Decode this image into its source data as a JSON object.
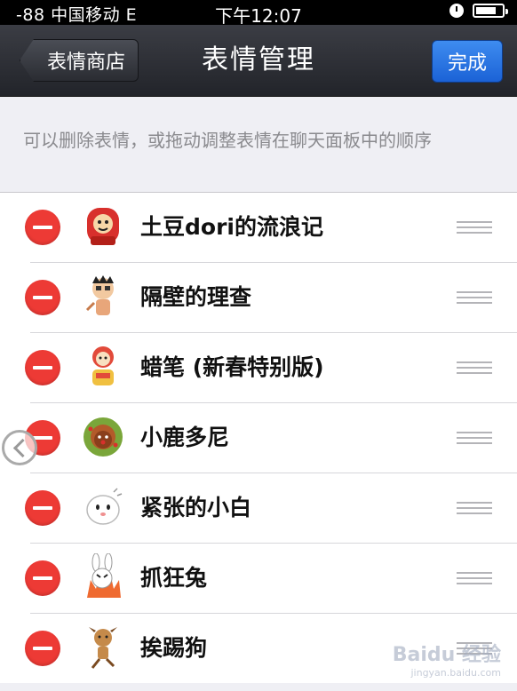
{
  "status_bar": {
    "signal": "-88 中国移动  E",
    "time": "下午12:07"
  },
  "nav": {
    "back_label": "表情商店",
    "title": "表情管理",
    "done_label": "完成"
  },
  "hint": "可以删除表情，或拖动调整表情在聊天面板中的顺序",
  "packs": [
    {
      "name": "土豆dori的流浪记",
      "icon": "potato-girl-icon",
      "color": "#d8302c"
    },
    {
      "name": "隔壁的理查",
      "icon": "richard-cartoon-icon",
      "color": "#e9b98c"
    },
    {
      "name": "蜡笔 (新春特别版)",
      "icon": "crayon-lion-dance-icon",
      "color": "#e24a3a"
    },
    {
      "name": "小鹿多尼",
      "icon": "deer-wreath-icon",
      "color": "#7aa63a"
    },
    {
      "name": "紧张的小白",
      "icon": "white-blob-icon",
      "color": "#f3f3f3"
    },
    {
      "name": "抓狂兔",
      "icon": "angry-rabbit-icon",
      "color": "#ef6a30"
    },
    {
      "name": "挨踢狗",
      "icon": "kicked-dog-icon",
      "color": "#c58a4a"
    }
  ],
  "watermark": {
    "brand": "Baidu 经验",
    "url": "jingyan.baidu.com"
  }
}
